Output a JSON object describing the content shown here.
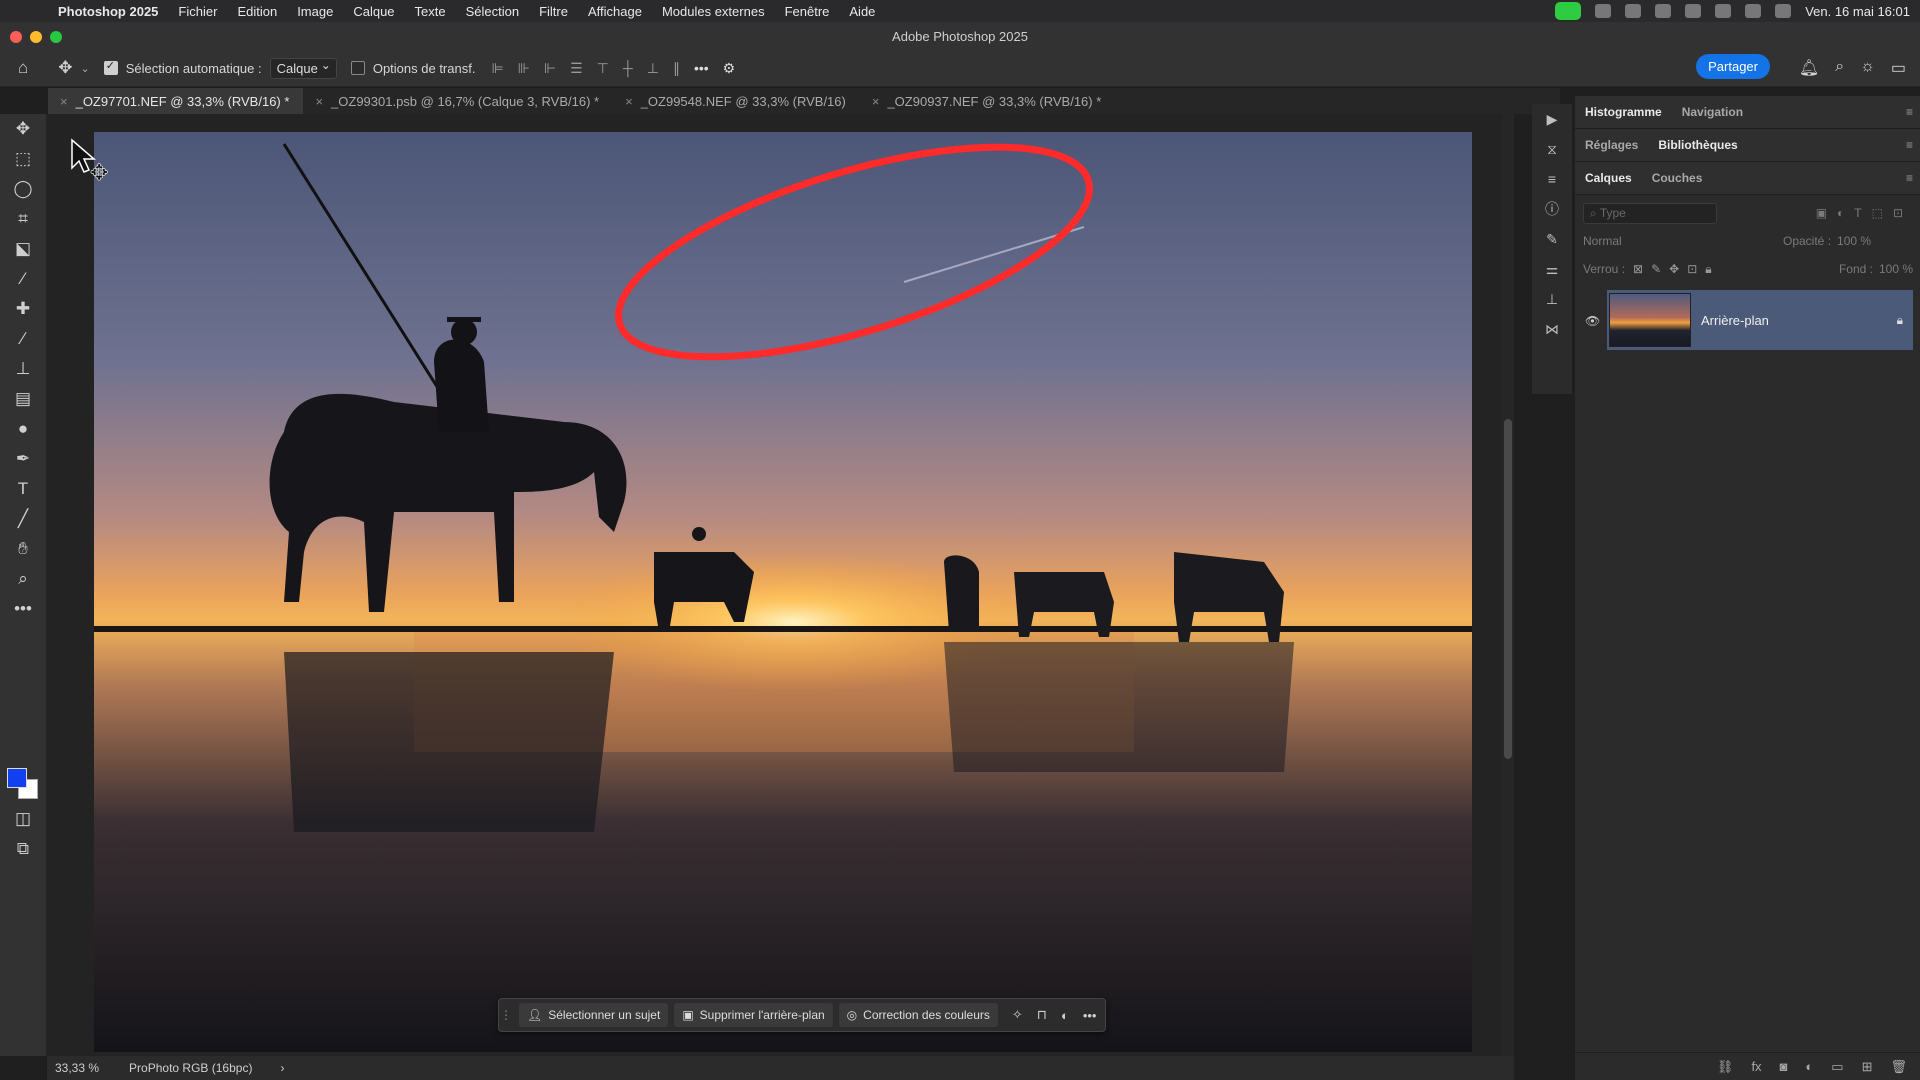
{
  "menubar": {
    "app_name": "Photoshop 2025",
    "items": [
      "Fichier",
      "Edition",
      "Image",
      "Calque",
      "Texte",
      "Sélection",
      "Filtre",
      "Affichage",
      "Modules externes",
      "Fenêtre",
      "Aide"
    ],
    "clock": "Ven. 16 mai  16:01"
  },
  "window": {
    "title": "Adobe Photoshop 2025"
  },
  "options": {
    "auto_select_label": "Sélection automatique :",
    "auto_select_value": "Calque",
    "transform_label": "Options de transf.",
    "share_label": "Partager"
  },
  "tabs": [
    {
      "label": "_OZ97701.NEF @ 33,3% (RVB/16) *"
    },
    {
      "label": "_OZ99301.psb @ 16,7% (Calque 3, RVB/16) *"
    },
    {
      "label": "_OZ99548.NEF @ 33,3% (RVB/16)"
    },
    {
      "label": "_OZ90937.NEF @ 33,3% (RVB/16) *"
    }
  ],
  "taskbar": {
    "select_subject": "Sélectionner un sujet",
    "remove_bg": "Supprimer l'arrière-plan",
    "color_correction": "Correction des couleurs"
  },
  "status": {
    "zoom": "33,33 %",
    "profile": "ProPhoto RGB (16bpc)",
    "arrow": "›"
  },
  "panels": {
    "row1": [
      "Histogramme",
      "Navigation"
    ],
    "row2": [
      "Réglages",
      "Bibliothèques"
    ],
    "row3": [
      "Calques",
      "Couches"
    ],
    "filter_placeholder": "Type",
    "blend_mode": "Normal",
    "opacity_label": "Opacité :",
    "opacity_value": "100 %",
    "lock_label": "Verrou :",
    "fill_label": "Fond :",
    "fill_value": "100 %",
    "layer_name": "Arrière-plan"
  },
  "colors": {
    "foreground": "#1040f0",
    "background": "#ffffff",
    "accent": "#1473e6",
    "annotation": "#ff2a2a"
  }
}
